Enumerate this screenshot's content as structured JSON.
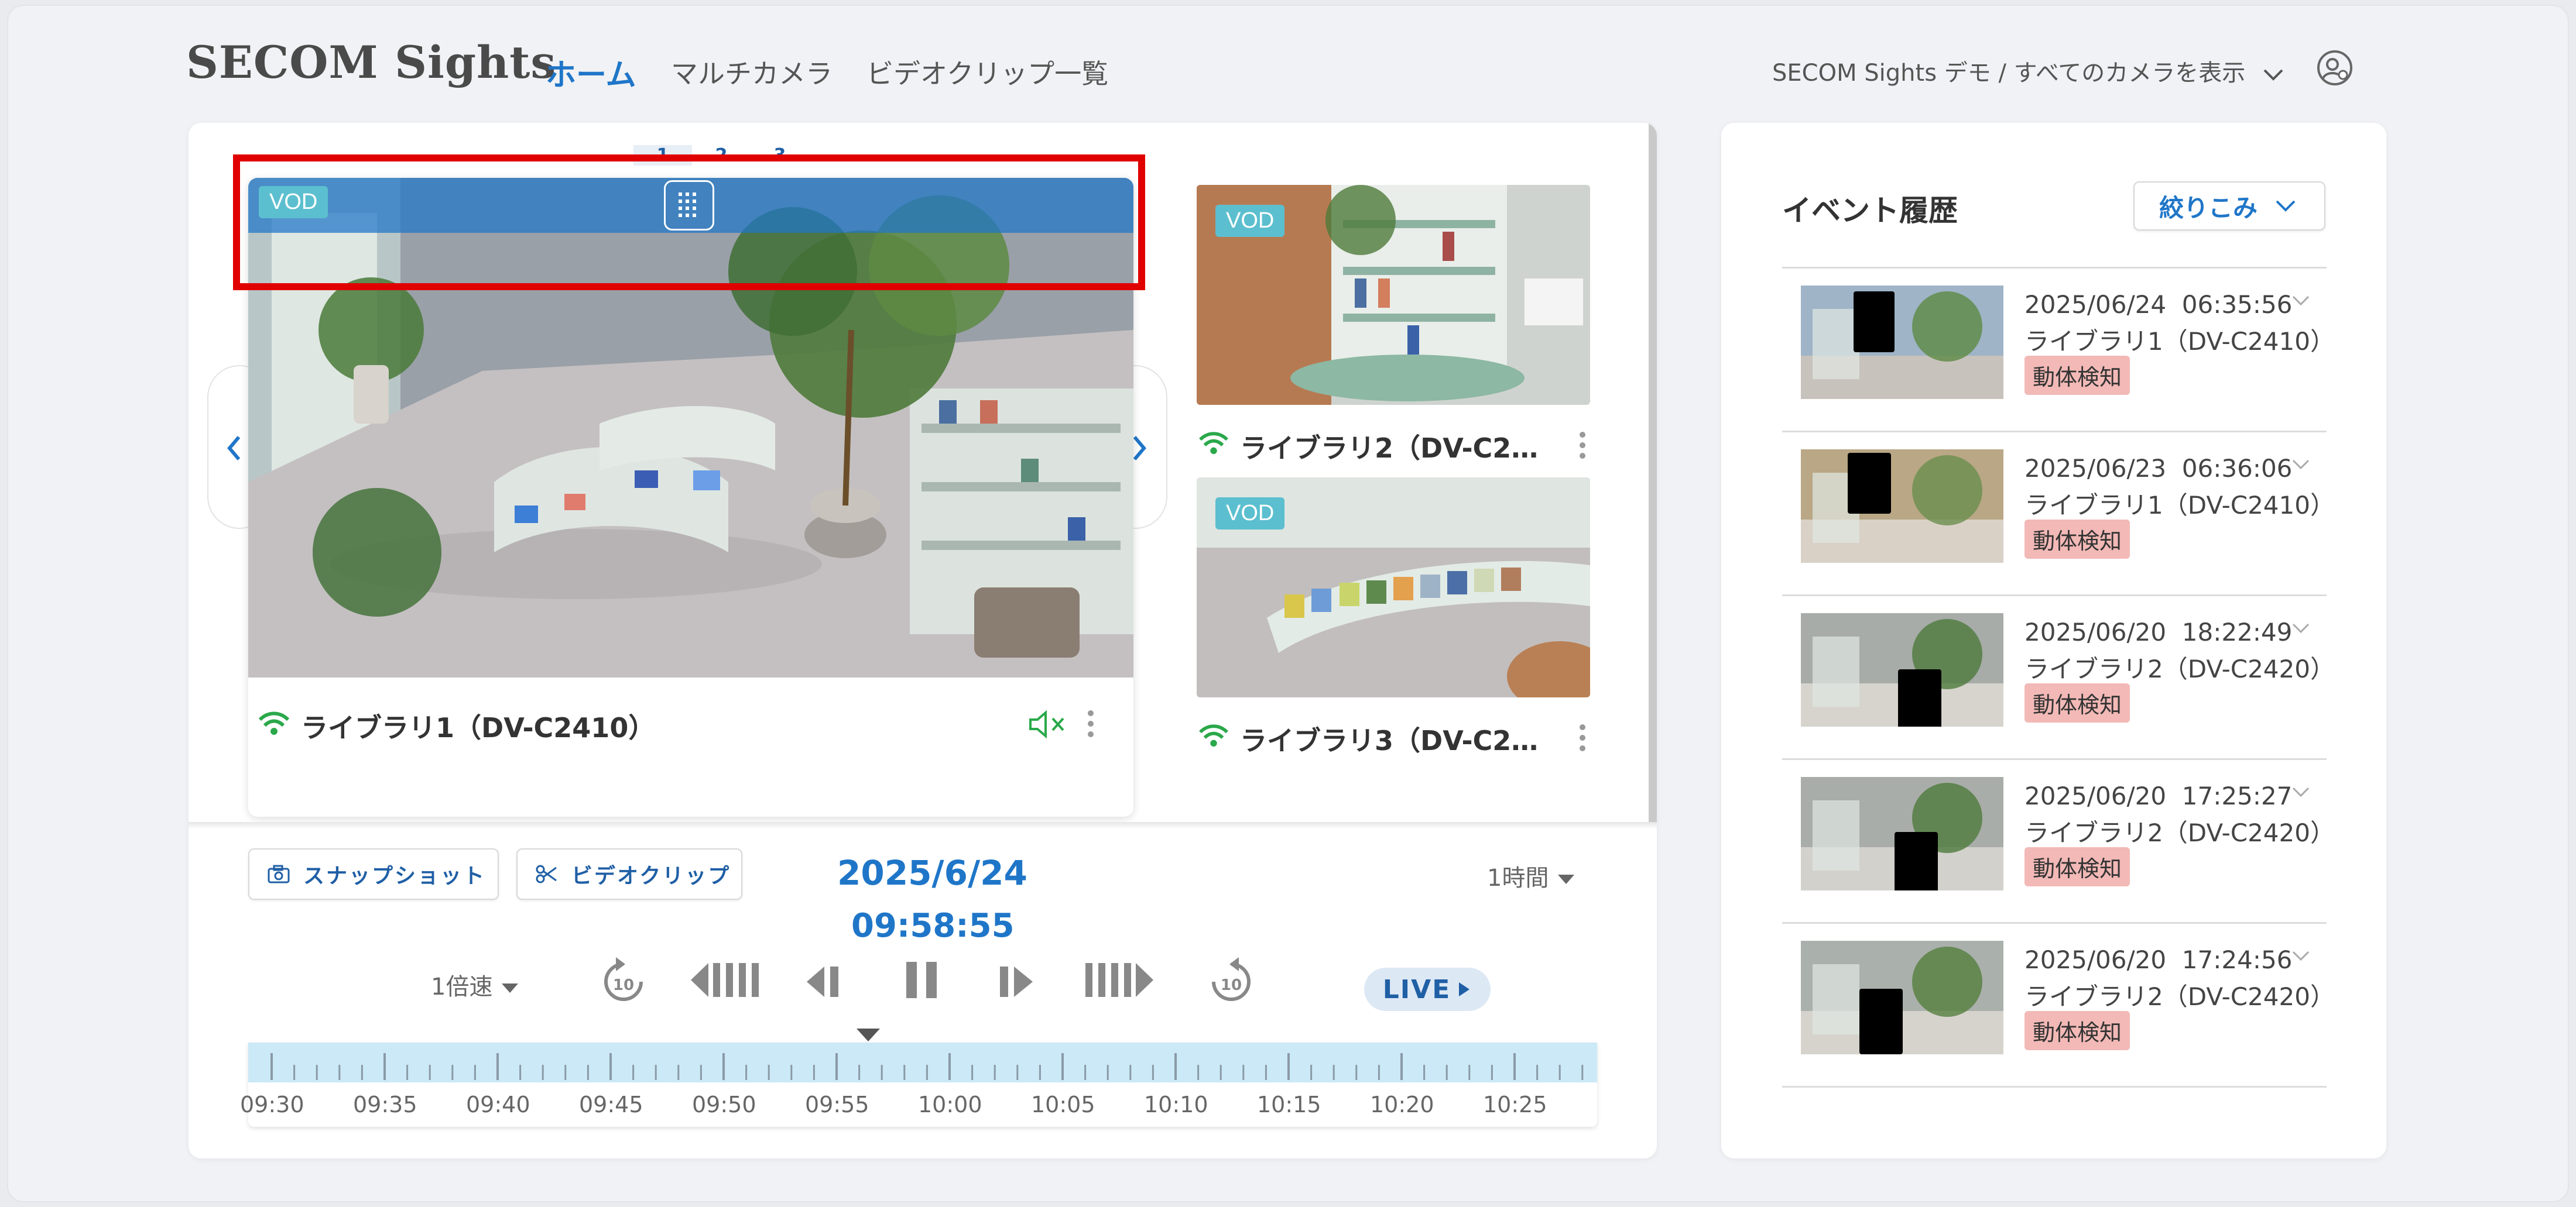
{
  "header": {
    "logo": "SECOM Sights",
    "nav": [
      "ホーム",
      "マルチカメラ",
      "ビデオクリップ一覧"
    ],
    "account_switch": "SECOM Sights デモ / すべてのカメラを表示"
  },
  "viewer": {
    "pager": [
      "1",
      "2",
      "3"
    ],
    "main_camera": {
      "name": "ライブラリ1（DV-C2410）",
      "badge": "VOD"
    },
    "side_cameras": [
      {
        "name": "ライブラリ2（DV-C2…",
        "badge": "VOD"
      },
      {
        "name": "ライブラリ3（DV-C2…",
        "badge": "VOD"
      }
    ]
  },
  "controls": {
    "snapshot": "スナップショット",
    "videoclip": "ビデオクリップ",
    "date": "2025/6/24",
    "time": "09:58:55",
    "range": "1時間",
    "speed": "1倍速",
    "live": "LIVE",
    "skip_seconds": "10",
    "timeline_labels": [
      "09:30",
      "09:35",
      "09:40",
      "09:45",
      "09:50",
      "09:55",
      "10:00",
      "10:05",
      "10:10",
      "10:15",
      "10:20",
      "10:25"
    ]
  },
  "events": {
    "title": "イベント履歴",
    "filter": "絞りこみ",
    "items": [
      {
        "datetime": "2025/06/24  06:35:56",
        "camera": "ライブラリ1（DV-C2410）",
        "tag": "動体検知"
      },
      {
        "datetime": "2025/06/23  06:36:06",
        "camera": "ライブラリ1（DV-C2410）",
        "tag": "動体検知"
      },
      {
        "datetime": "2025/06/20  18:22:49",
        "camera": "ライブラリ2（DV-C2420）",
        "tag": "動体検知"
      },
      {
        "datetime": "2025/06/20  17:25:27",
        "camera": "ライブラリ2（DV-C2420）",
        "tag": "動体検知"
      },
      {
        "datetime": "2025/06/20  17:24:56",
        "camera": "ライブラリ2（DV-C2420）",
        "tag": "動体検知"
      }
    ]
  },
  "colors": {
    "accent": "#1f76c8",
    "overlay": "#1f76c8",
    "badge_vod": "#5cbfcf",
    "event_tag": "#f2b9b6",
    "wifi_ok": "#2aa84a",
    "highlight": "#e00000"
  }
}
